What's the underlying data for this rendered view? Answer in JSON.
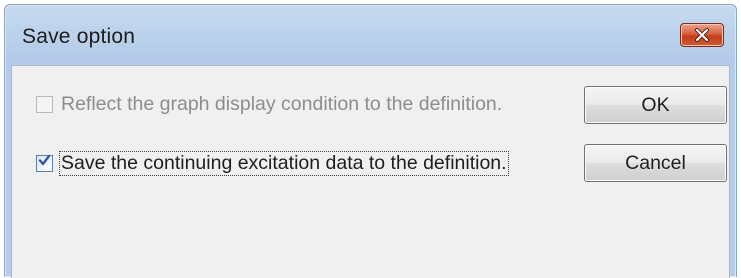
{
  "dialog": {
    "title": "Save option",
    "close_icon": "close-icon",
    "options": [
      {
        "label": "Reflect the graph display condition to the definition.",
        "checked": false,
        "enabled": false
      },
      {
        "label": "Save the continuing excitation data to the definition.",
        "checked": true,
        "enabled": true
      }
    ],
    "buttons": {
      "ok_label": "OK",
      "cancel_label": "Cancel"
    }
  },
  "colors": {
    "titlebar": "#bcd2ec",
    "client_background": "#f0f0f0",
    "close_button": "#c63d1b",
    "checkmark": "#3557a8",
    "disabled_text": "#8d8d8d"
  }
}
